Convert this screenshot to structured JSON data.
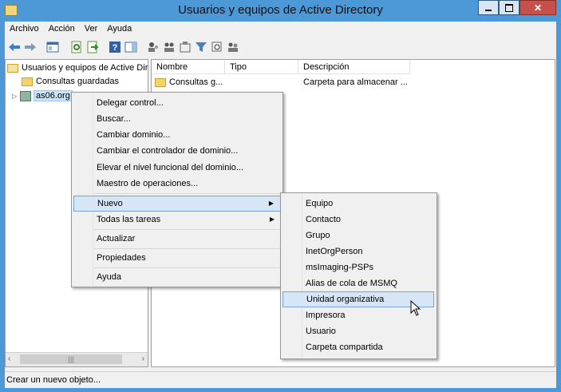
{
  "window": {
    "title": "Usuarios y equipos de Active Directory"
  },
  "menubar": {
    "items": [
      "Archivo",
      "Acción",
      "Ver",
      "Ayuda"
    ]
  },
  "tree": {
    "root": "Usuarios y equipos de Active Dir",
    "saved_queries": "Consultas guardadas",
    "domain": "as06.org"
  },
  "list": {
    "columns": [
      "Nombre",
      "Tipo",
      "Descripción"
    ],
    "rows": [
      {
        "name": "Consultas g...",
        "type": "",
        "description": "Carpeta para almacenar ..."
      }
    ]
  },
  "context_menu": {
    "items": [
      "Delegar control...",
      "Buscar...",
      "Cambiar dominio...",
      "Cambiar el controlador de dominio...",
      "Elevar el nivel funcional del dominio...",
      "Maestro de operaciones...",
      "Nuevo",
      "Todas las tareas",
      "Actualizar",
      "Propiedades",
      "Ayuda"
    ]
  },
  "submenu": {
    "items": [
      "Equipo",
      "Contacto",
      "Grupo",
      "InetOrgPerson",
      "msImaging-PSPs",
      "Alias de cola de MSMQ",
      "Unidad organizativa",
      "Impresora",
      "Usuario",
      "Carpeta compartida"
    ]
  },
  "statusbar": {
    "text": "Crear un nuevo objeto..."
  },
  "colors": {
    "titlebar": "#4d98d6",
    "highlight": "#d6e6f6",
    "highlight_border": "#7da2ce",
    "close": "#c7504a"
  }
}
